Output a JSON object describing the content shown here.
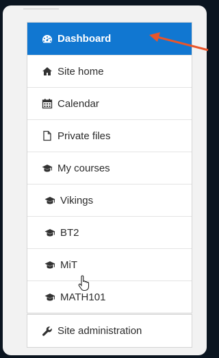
{
  "nav": {
    "items": [
      {
        "label": "Dashboard",
        "icon": "dashboard-icon",
        "active": true
      },
      {
        "label": "Site home",
        "icon": "home-icon"
      },
      {
        "label": "Calendar",
        "icon": "calendar-icon"
      },
      {
        "label": "Private files",
        "icon": "file-icon"
      },
      {
        "label": "My courses",
        "icon": "graduation-cap-icon"
      },
      {
        "label": "Vikings",
        "icon": "graduation-cap-icon"
      },
      {
        "label": "BT2",
        "icon": "graduation-cap-icon"
      },
      {
        "label": "MiT",
        "icon": "graduation-cap-icon"
      },
      {
        "label": "MATH101",
        "icon": "graduation-cap-icon"
      }
    ],
    "admin": {
      "label": "Site administration",
      "icon": "wrench-icon"
    }
  },
  "colors": {
    "active_bg": "#1177d1",
    "annotation_arrow": "#e8552a"
  }
}
